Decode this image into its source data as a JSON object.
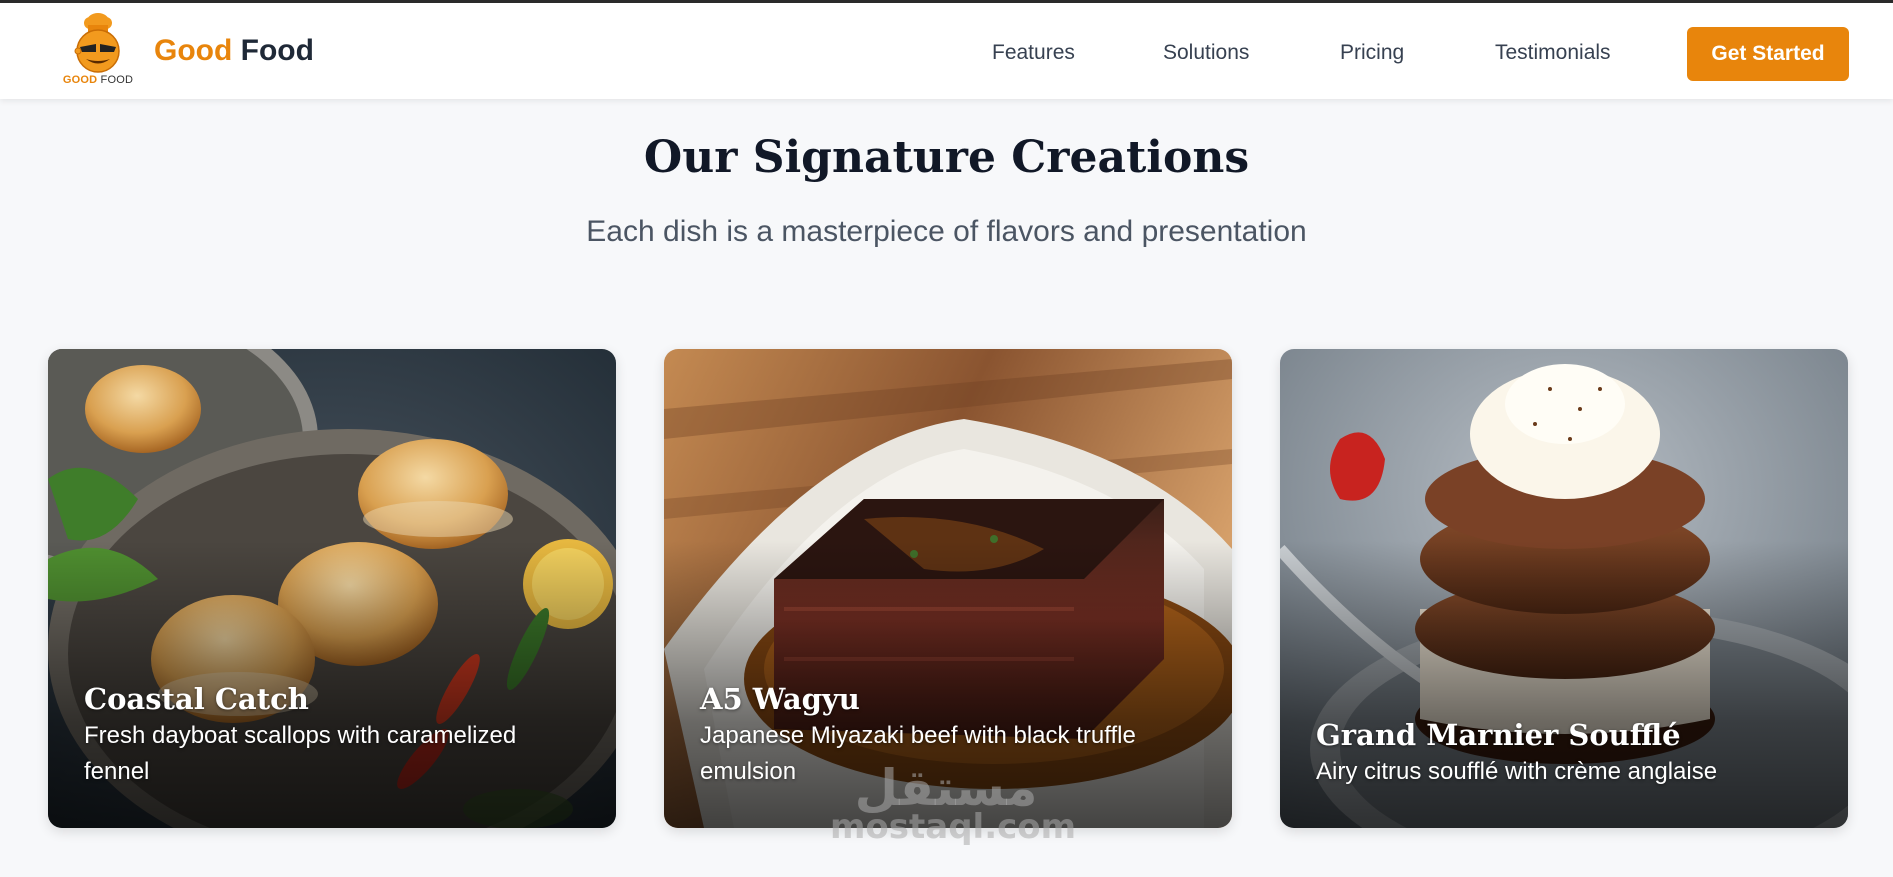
{
  "colors": {
    "accent": "#e8850c",
    "heading": "#111827",
    "subtext": "#4b5563",
    "background": "#f7f8fa"
  },
  "header": {
    "logo_icon": "chef-mascot-icon",
    "logo_mark_text_1": "GOOD",
    "logo_mark_text_2": "FOOD",
    "brand_part_1": "Good",
    "brand_part_2": "Food",
    "nav": [
      "Features",
      "Solutions",
      "Pricing",
      "Testimonials"
    ],
    "cta_label": "Get Started"
  },
  "section": {
    "title": "Our Signature Creations",
    "subtitle": "Each dish is a masterpiece of flavors and presentation"
  },
  "dishes": [
    {
      "title": "Coastal Catch",
      "description": "Fresh dayboat scallops with caramelized fennel",
      "image": "scallops-plate-photo"
    },
    {
      "title": "A5 Wagyu",
      "description": "Japanese Miyazaki beef with black truffle emulsion",
      "image": "wagyu-steak-photo"
    },
    {
      "title": "Grand Marnier Soufflé",
      "description": "Airy citrus soufflé with crème anglaise",
      "image": "chocolate-souffle-photo"
    }
  ],
  "watermark": {
    "arabic": "مستقل",
    "latin": "mostaql.com"
  }
}
